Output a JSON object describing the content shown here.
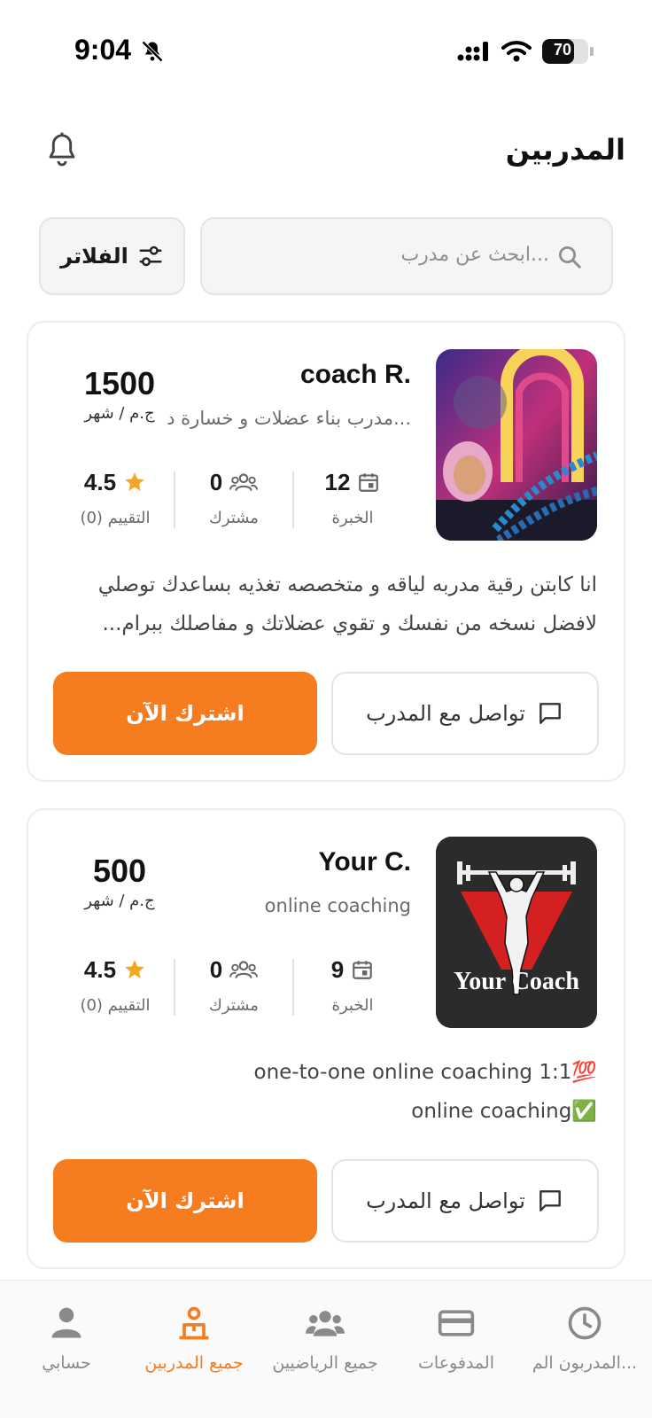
{
  "status": {
    "time": "9:04",
    "battery": "70",
    "battery_level": 0.7
  },
  "header": {
    "title": "المدربين"
  },
  "search": {
    "placeholder": "ابحث عن مدرب...",
    "filter_label": "الفلاتر"
  },
  "coaches": [
    {
      "name": "coach R.",
      "subtitle": "مدرب بناء عضلات و خسارة د...",
      "price": "1500",
      "price_unit": "ج.م / شهر",
      "experience": "12",
      "experience_label": "الخبرة",
      "subscribers": "0",
      "subscribers_label": "مشترك",
      "rating": "4.5",
      "rating_label": "(0) التقييم",
      "description": "انا كابتن رقية مدربه لياقه و متخصصه تغذيه بساعدك توصلي لافضل نسخه من نفسك و تقوي عضلاتك و مفاصلك  ببرام...",
      "contact_label": "تواصل مع المدرب",
      "subscribe_label": "اشترك الآن"
    },
    {
      "name": "Your C.",
      "subtitle": "online coaching",
      "price": "500",
      "price_unit": "ج.م / شهر",
      "experience": "9",
      "experience_label": "الخبرة",
      "subscribers": "0",
      "subscribers_label": "مشترك",
      "rating": "4.5",
      "rating_label": "(0) التقييم",
      "description_line1": "one-to-one online coaching 1:1💯",
      "description_line2": "online coaching✅",
      "logo_text": "Your Coach",
      "contact_label": "تواصل مع المدرب",
      "subscribe_label": "اشترك الآن"
    }
  ],
  "nav": [
    {
      "label": "المدربون الم...",
      "icon": "clock-icon"
    },
    {
      "label": "المدفوعات",
      "icon": "credit-card-icon"
    },
    {
      "label": "جميع الرياضيين",
      "icon": "group-icon"
    },
    {
      "label": "جميع المدربين",
      "icon": "coach-icon",
      "active": true
    },
    {
      "label": "حسابي",
      "icon": "person-icon"
    }
  ],
  "colors": {
    "accent": "#f57c1f",
    "star": "#f5a623",
    "nav_inactive": "#8a8a8a"
  }
}
